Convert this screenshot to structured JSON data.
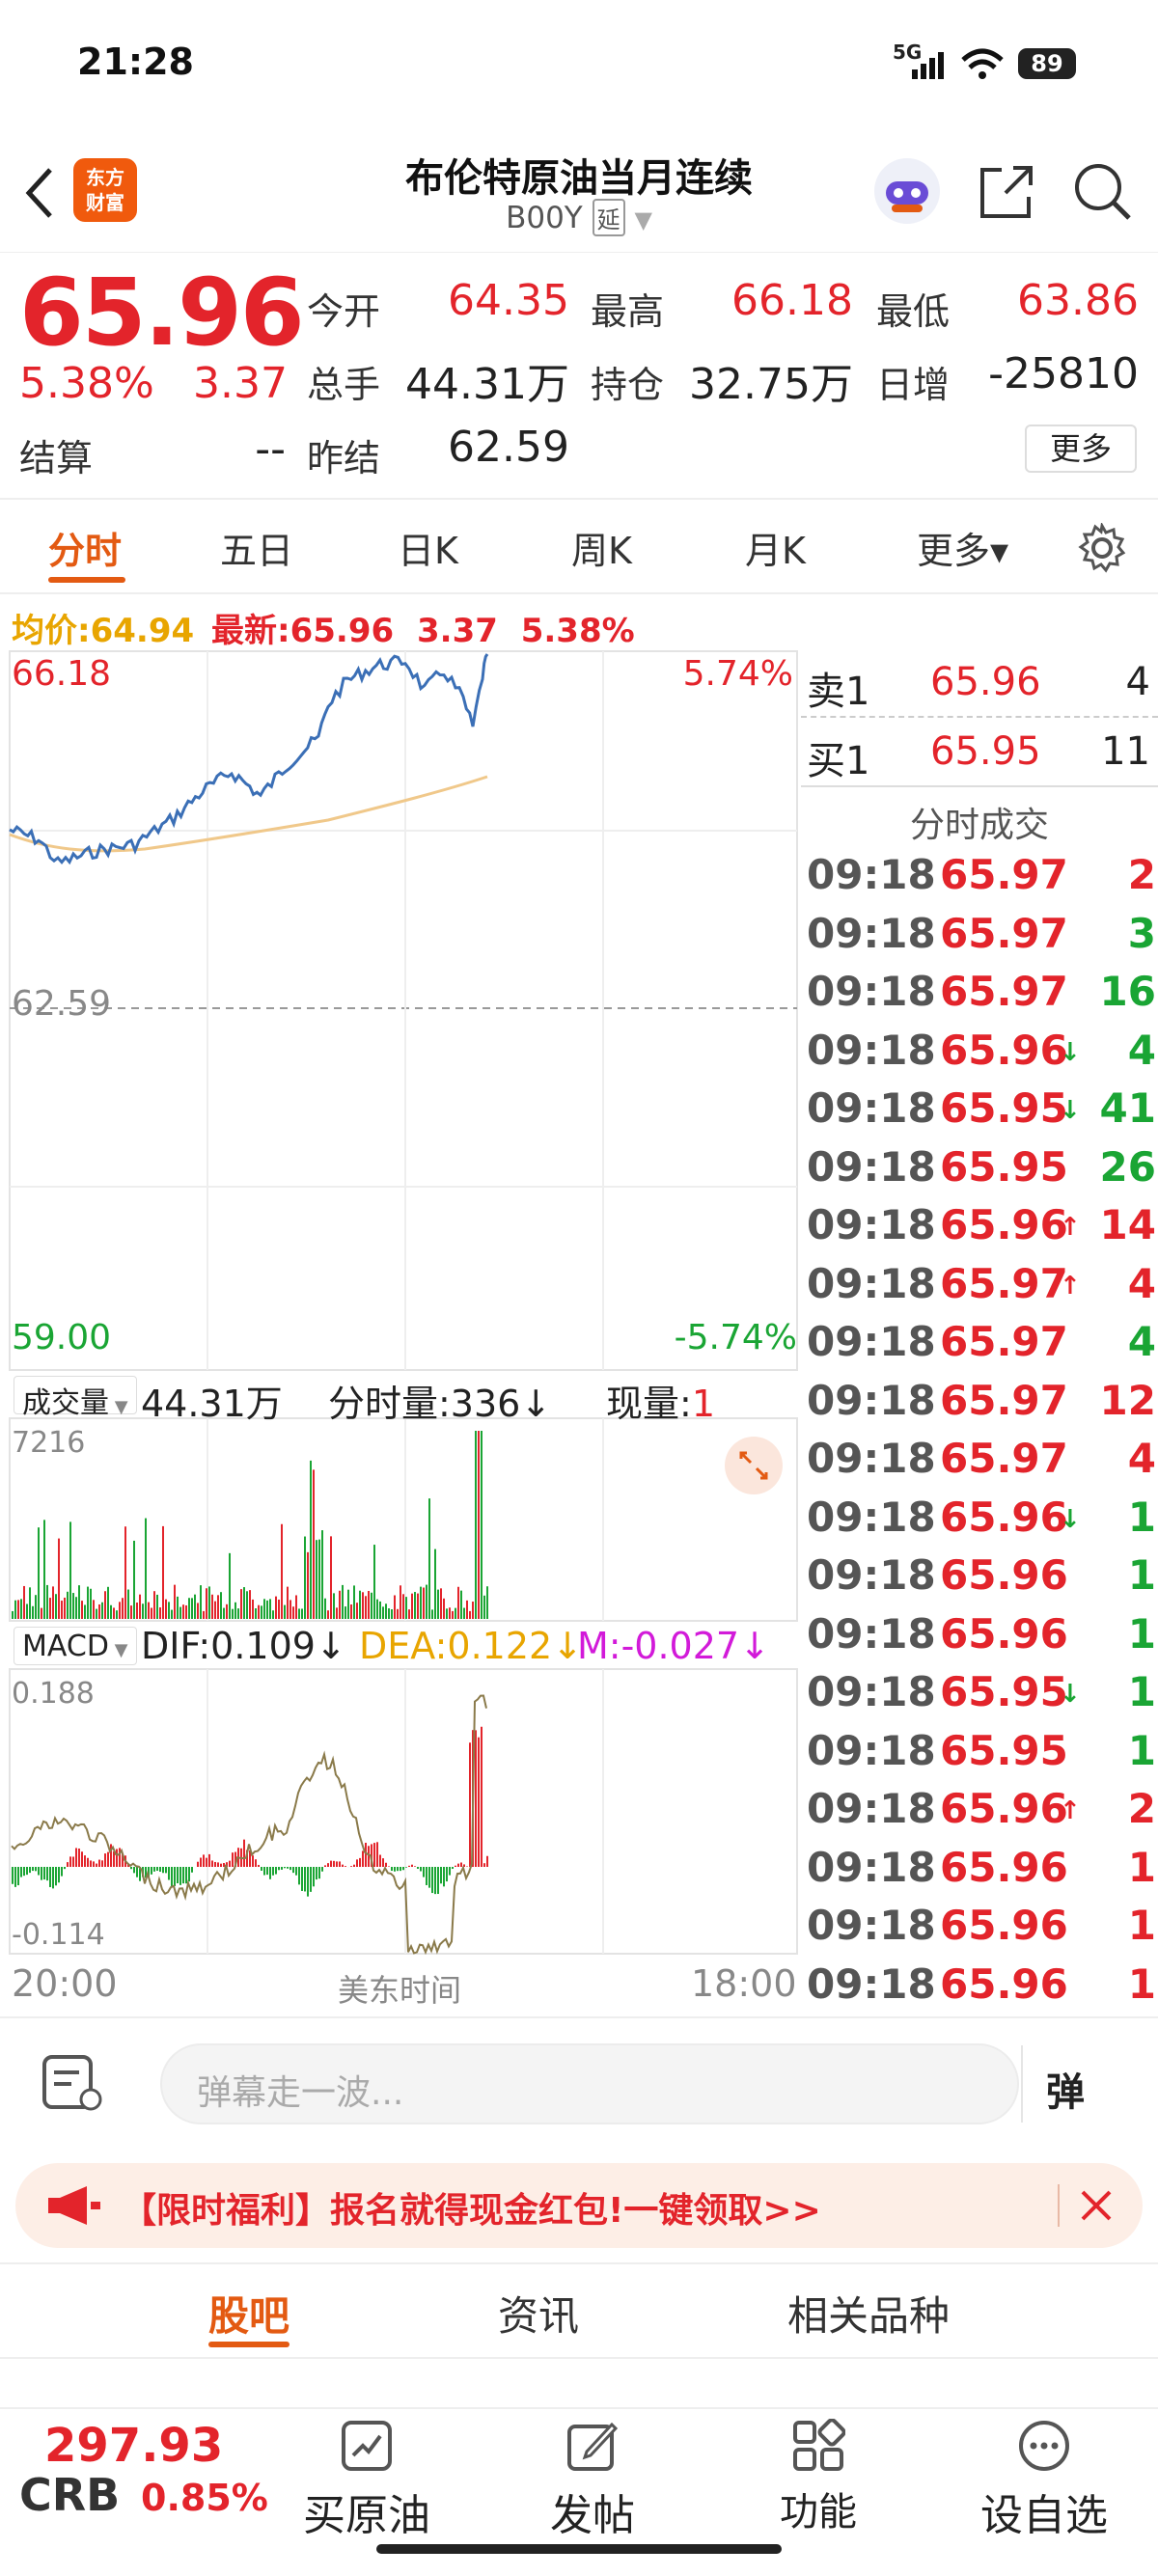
{
  "status": {
    "time": "21:28",
    "network": "5G",
    "battery": "89"
  },
  "nav": {
    "title": "布伦特原油当月连续",
    "code": "B00Y",
    "tag": "延",
    "logo": "东方\n财富"
  },
  "quote": {
    "price": "65.96",
    "change_pct": "5.38%",
    "change": "3.37",
    "open_label": "今开",
    "open": "64.35",
    "high_label": "最高",
    "high": "66.18",
    "low_label": "最低",
    "low": "63.86",
    "volume_label": "总手",
    "volume": "44.31万",
    "oi_label": "持仓",
    "oi": "32.75万",
    "daily_inc_label": "日增",
    "daily_inc": "-25810",
    "settle_label": "结算",
    "settle": "--",
    "prev_settle_label": "昨结",
    "prev_settle": "62.59",
    "more_label": "更多"
  },
  "tabs": [
    {
      "label": "分时",
      "active": true
    },
    {
      "label": "五日"
    },
    {
      "label": "日K"
    },
    {
      "label": "周K"
    },
    {
      "label": "月K"
    },
    {
      "label": "更多▾"
    }
  ],
  "avg_line": {
    "avg_label": "均价:",
    "avg": "64.94",
    "latest_label": "最新:",
    "latest": "65.96",
    "chg": "3.37",
    "pct": "5.38%"
  },
  "chart": {
    "max_price": "66.18",
    "max_pct": "5.74%",
    "mid_price": "62.59",
    "min_price": "59.00",
    "min_pct": "-5.74%",
    "vol_selector": "成交量",
    "vol_total": "44.31万",
    "vol_period": "分时量:336↓",
    "vol_now_label": "现量:",
    "vol_now": "1",
    "vol_max": "7216",
    "macd_selector": "MACD",
    "dif": "DIF:0.109↓",
    "dea": "DEA:0.122↓",
    "m": "M:-0.027↓",
    "macd_max": "0.188",
    "macd_min": "-0.114",
    "time_start": "20:00",
    "time_mid": "美东时间",
    "time_end": "18:00"
  },
  "orderbook": {
    "sell": {
      "label": "卖1",
      "price": "65.96",
      "qty": "4"
    },
    "buy": {
      "label": "买1",
      "price": "65.95",
      "qty": "11"
    },
    "trades_title": "分时成交"
  },
  "trades": [
    {
      "time": "09:18",
      "price": "65.97",
      "arrow": "",
      "qty": "2",
      "side": "red"
    },
    {
      "time": "09:18",
      "price": "65.97",
      "arrow": "",
      "qty": "3",
      "side": "green"
    },
    {
      "time": "09:18",
      "price": "65.97",
      "arrow": "",
      "qty": "16",
      "side": "green"
    },
    {
      "time": "09:18",
      "price": "65.96",
      "arrow": "↓",
      "qty": "4",
      "side": "green"
    },
    {
      "time": "09:18",
      "price": "65.95",
      "arrow": "↓",
      "qty": "41",
      "side": "green"
    },
    {
      "time": "09:18",
      "price": "65.95",
      "arrow": "",
      "qty": "26",
      "side": "green"
    },
    {
      "time": "09:18",
      "price": "65.96",
      "arrow": "↑",
      "qty": "14",
      "side": "red"
    },
    {
      "time": "09:18",
      "price": "65.97",
      "arrow": "↑",
      "qty": "4",
      "side": "red"
    },
    {
      "time": "09:18",
      "price": "65.97",
      "arrow": "",
      "qty": "4",
      "side": "green"
    },
    {
      "time": "09:18",
      "price": "65.97",
      "arrow": "",
      "qty": "12",
      "side": "red"
    },
    {
      "time": "09:18",
      "price": "65.97",
      "arrow": "",
      "qty": "4",
      "side": "red"
    },
    {
      "time": "09:18",
      "price": "65.96",
      "arrow": "↓",
      "qty": "1",
      "side": "green"
    },
    {
      "time": "09:18",
      "price": "65.96",
      "arrow": "",
      "qty": "1",
      "side": "green"
    },
    {
      "time": "09:18",
      "price": "65.96",
      "arrow": "",
      "qty": "1",
      "side": "green"
    },
    {
      "time": "09:18",
      "price": "65.95",
      "arrow": "↓",
      "qty": "1",
      "side": "green"
    },
    {
      "time": "09:18",
      "price": "65.95",
      "arrow": "",
      "qty": "1",
      "side": "green"
    },
    {
      "time": "09:18",
      "price": "65.96",
      "arrow": "↑",
      "qty": "2",
      "side": "red"
    },
    {
      "time": "09:18",
      "price": "65.96",
      "arrow": "",
      "qty": "1",
      "side": "red"
    },
    {
      "time": "09:18",
      "price": "65.96",
      "arrow": "",
      "qty": "1",
      "side": "red"
    },
    {
      "time": "09:18",
      "price": "65.96",
      "arrow": "",
      "qty": "1",
      "side": "red"
    }
  ],
  "comment": {
    "placeholder": "弹幕走一波...",
    "danmu": "弹"
  },
  "promo": {
    "text": "【限时福利】报名就得现金红包!一键领取>>"
  },
  "subtabs": [
    {
      "label": "股吧",
      "active": true
    },
    {
      "label": "资讯"
    },
    {
      "label": "相关品种"
    }
  ],
  "bottom": {
    "index_value": "297.93",
    "index_name": "CRB",
    "index_pct": "0.85%",
    "items": [
      "买原油",
      "发帖",
      "功能",
      "设自选"
    ]
  },
  "colors": {
    "up": "#e3242b",
    "down": "#1aa534",
    "accent": "#e35a12",
    "avg": "#e8a500",
    "price_line": "#3b6fb6"
  }
}
